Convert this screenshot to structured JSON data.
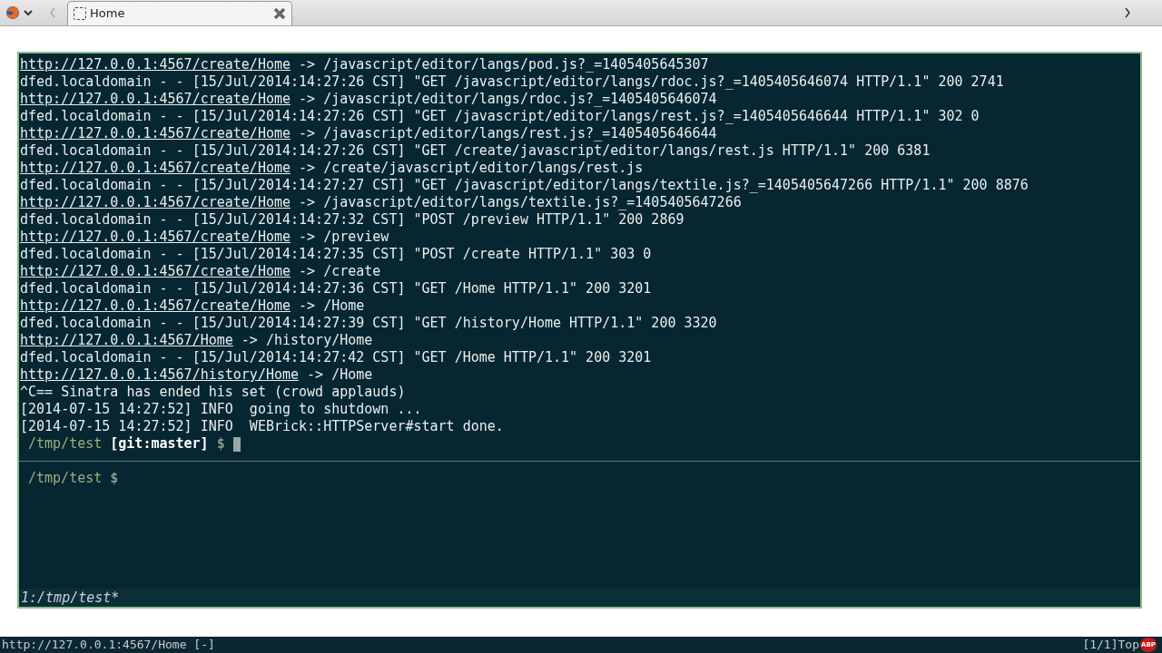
{
  "browser": {
    "tab": {
      "title": "Home",
      "selected": true
    }
  },
  "terminal": {
    "top_pane": {
      "lines": [
        {
          "kind": "redirect",
          "url": "http://127.0.0.1:4567/create/Home",
          "text": " -> /javascript/editor/langs/pod.js?_=1405405645307"
        },
        {
          "kind": "plain",
          "text": "dfed.localdomain - - [15/Jul/2014:14:27:26 CST] \"GET /javascript/editor/langs/rdoc.js?_=1405405646074 HTTP/1.1\" 200 2741"
        },
        {
          "kind": "redirect",
          "url": "http://127.0.0.1:4567/create/Home",
          "text": " -> /javascript/editor/langs/rdoc.js?_=1405405646074"
        },
        {
          "kind": "plain",
          "text": "dfed.localdomain - - [15/Jul/2014:14:27:26 CST] \"GET /javascript/editor/langs/rest.js?_=1405405646644 HTTP/1.1\" 302 0"
        },
        {
          "kind": "redirect",
          "url": "http://127.0.0.1:4567/create/Home",
          "text": " -> /javascript/editor/langs/rest.js?_=1405405646644"
        },
        {
          "kind": "plain",
          "text": "dfed.localdomain - - [15/Jul/2014:14:27:26 CST] \"GET /create/javascript/editor/langs/rest.js HTTP/1.1\" 200 6381"
        },
        {
          "kind": "redirect",
          "url": "http://127.0.0.1:4567/create/Home",
          "text": " -> /create/javascript/editor/langs/rest.js"
        },
        {
          "kind": "plain",
          "text": "dfed.localdomain - - [15/Jul/2014:14:27:27 CST] \"GET /javascript/editor/langs/textile.js?_=1405405647266 HTTP/1.1\" 200 8876"
        },
        {
          "kind": "redirect",
          "url": "http://127.0.0.1:4567/create/Home",
          "text": " -> /javascript/editor/langs/textile.js?_=1405405647266"
        },
        {
          "kind": "plain",
          "text": "dfed.localdomain - - [15/Jul/2014:14:27:32 CST] \"POST /preview HTTP/1.1\" 200 2869"
        },
        {
          "kind": "redirect",
          "url": "http://127.0.0.1:4567/create/Home",
          "text": " -> /preview"
        },
        {
          "kind": "plain",
          "text": "dfed.localdomain - - [15/Jul/2014:14:27:35 CST] \"POST /create HTTP/1.1\" 303 0"
        },
        {
          "kind": "redirect",
          "url": "http://127.0.0.1:4567/create/Home",
          "text": " -> /create"
        },
        {
          "kind": "plain",
          "text": "dfed.localdomain - - [15/Jul/2014:14:27:36 CST] \"GET /Home HTTP/1.1\" 200 3201"
        },
        {
          "kind": "redirect",
          "url": "http://127.0.0.1:4567/create/Home",
          "text": " -> /Home"
        },
        {
          "kind": "plain",
          "text": "dfed.localdomain - - [15/Jul/2014:14:27:39 CST] \"GET /history/Home HTTP/1.1\" 200 3320"
        },
        {
          "kind": "redirect",
          "url": "http://127.0.0.1:4567/Home",
          "text": " -> /history/Home"
        },
        {
          "kind": "plain",
          "text": "dfed.localdomain - - [15/Jul/2014:14:27:42 CST] \"GET /Home HTTP/1.1\" 200 3201"
        },
        {
          "kind": "redirect",
          "url": "http://127.0.0.1:4567/history/Home",
          "text": " -> /Home"
        },
        {
          "kind": "plain",
          "text": "^C== Sinatra has ended his set (crowd applauds)"
        },
        {
          "kind": "plain",
          "text": "[2014-07-15 14:27:52] INFO  going to shutdown ..."
        },
        {
          "kind": "plain",
          "text": "[2014-07-15 14:27:52] INFO  WEBrick::HTTPServer#start done."
        },
        {
          "kind": "prompt",
          "path": "/tmp/test",
          "branch": "[git:master]",
          "symbol": "$",
          "cursor": true
        }
      ]
    },
    "bottom_pane": {
      "lines": [
        {
          "kind": "prompt",
          "path": "/tmp/test",
          "symbol": "$",
          "cursor": false
        }
      ]
    },
    "status_line": "1:/tmp/test*"
  },
  "status_bar": {
    "url": "http://127.0.0.1:4567/Home [-]",
    "position": "[1/1]Top",
    "badge": "ABP"
  }
}
